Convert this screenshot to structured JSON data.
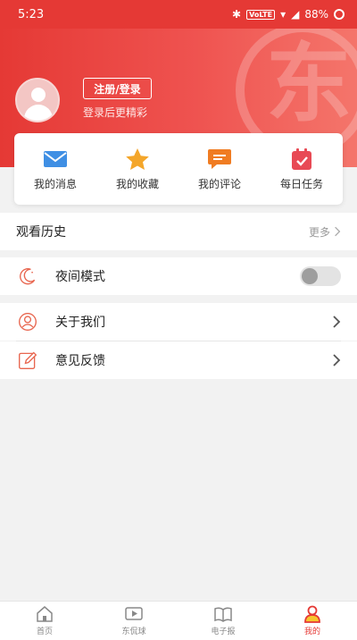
{
  "status_bar": {
    "time": "5:23",
    "network": "VoLTE",
    "battery": "88%"
  },
  "hero": {
    "watermark_char": "东"
  },
  "profile": {
    "login_button": "注册/登录",
    "login_tip": "登录后更精彩"
  },
  "quick_actions": [
    {
      "label": "我的消息",
      "icon": "mail-icon",
      "color": "#3f8fe4"
    },
    {
      "label": "我的收藏",
      "icon": "star-icon",
      "color": "#f4a62a"
    },
    {
      "label": "我的评论",
      "icon": "comment-icon",
      "color": "#f07c22"
    },
    {
      "label": "每日任务",
      "icon": "task-icon",
      "color": "#e84a55"
    }
  ],
  "history": {
    "title": "观看历史",
    "more": "更多"
  },
  "settings": {
    "night_mode": {
      "label": "夜间模式",
      "enabled": false
    },
    "about": {
      "label": "关于我们"
    },
    "feedback": {
      "label": "意见反馈"
    }
  },
  "tabbar": {
    "items": [
      {
        "label": "首页",
        "icon": "home-icon"
      },
      {
        "label": "东侃球",
        "icon": "video-icon"
      },
      {
        "label": "电子报",
        "icon": "newspaper-icon"
      },
      {
        "label": "我的",
        "icon": "user-icon",
        "active": true
      }
    ]
  },
  "colors": {
    "brand": "#e53935",
    "accent_highlight": "#f7c52e"
  }
}
